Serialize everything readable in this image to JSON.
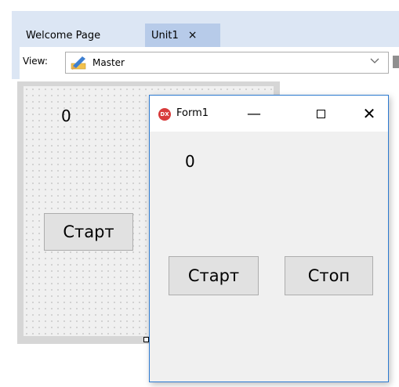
{
  "tabs": [
    {
      "label": "Welcome Page"
    },
    {
      "label": "Unit1",
      "close_glyph": "×"
    }
  ],
  "toolbar": {
    "view_label": "View:",
    "view_value": "Master",
    "view_icon": "master-view-icon"
  },
  "designer": {
    "label_text": "0",
    "start_button": "Старт"
  },
  "form1": {
    "title": "Form1",
    "app_icon_text": "DX",
    "minimize_glyph": "—",
    "close_glyph": "✕",
    "label_text": "0",
    "start_button": "Старт",
    "stop_button": "Стоп"
  },
  "colors": {
    "ide_background": "#dce6f4",
    "active_tab": "#b7cbe9",
    "form_border": "#2b79d0",
    "form_background": "#f0f0f0",
    "button_face": "#e1e1e1"
  }
}
